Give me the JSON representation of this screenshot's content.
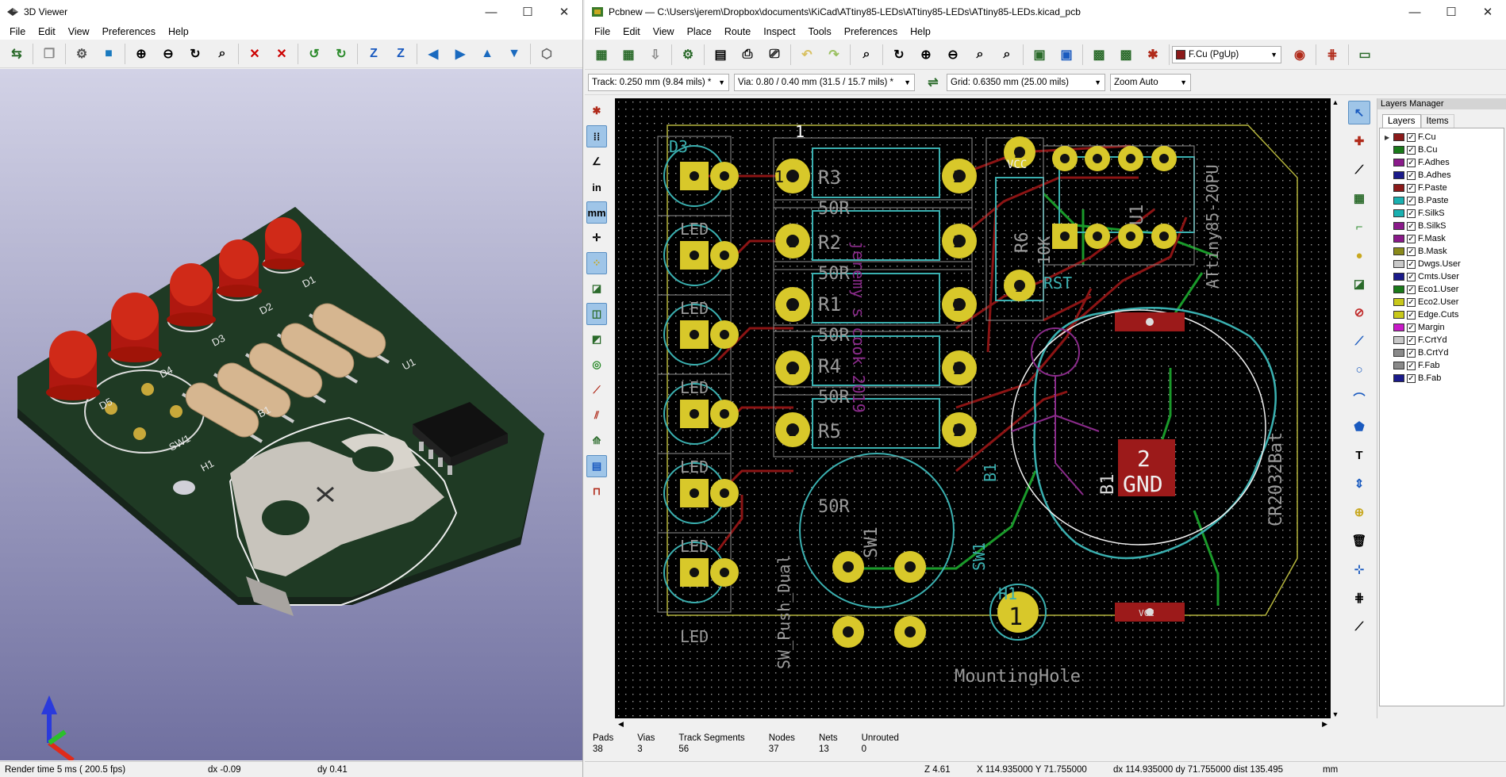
{
  "viewer": {
    "title": "3D Viewer",
    "controls": {
      "min": "—",
      "max": "☐",
      "close": "✕"
    },
    "menu": [
      "File",
      "Edit",
      "View",
      "Preferences",
      "Help"
    ],
    "status": {
      "render": "Render time 5 ms ( 200.5 fps)",
      "dx": "dx -0.09",
      "dy": "dy 0.41"
    },
    "board": {
      "silk": [
        "D5",
        "D4",
        "D3",
        "D2",
        "D1",
        "SW1",
        "H1",
        "B1",
        "U1"
      ],
      "accent": "#1e2f1c"
    }
  },
  "pcbnew": {
    "title": "Pcbnew — C:\\Users\\jerem\\Dropbox\\documents\\KiCad\\ATtiny85-LEDs\\ATtiny85-LEDs\\ATtiny85-LEDs.kicad_pcb",
    "controls": {
      "min": "—",
      "max": "☐",
      "close": "✕"
    },
    "menu": [
      "File",
      "Edit",
      "View",
      "Place",
      "Route",
      "Inspect",
      "Tools",
      "Preferences",
      "Help"
    ],
    "layer_select": "F.Cu (PgUp)",
    "track": "Track: 0.250 mm (9.84 mils) *",
    "via": "Via: 0.80 / 0.40 mm (31.5 / 15.7 mils) *",
    "grid": "Grid: 0.6350 mm (25.00 mils)",
    "zoom": "Zoom Auto",
    "left_tools": {
      "in": "in",
      "mm": "mm"
    },
    "layers_manager": {
      "title": "Layers Manager",
      "tabs": [
        "Layers",
        "Items"
      ],
      "layers": [
        {
          "name": "F.Cu",
          "color": "#8b1a1a"
        },
        {
          "name": "B.Cu",
          "color": "#1a7a1a"
        },
        {
          "name": "F.Adhes",
          "color": "#8a1a8a"
        },
        {
          "name": "B.Adhes",
          "color": "#1a1a8a"
        },
        {
          "name": "F.Paste",
          "color": "#8b1a1a"
        },
        {
          "name": "B.Paste",
          "color": "#1ab0b0"
        },
        {
          "name": "F.SilkS",
          "color": "#1ab0b0"
        },
        {
          "name": "B.SilkS",
          "color": "#8a1a8a"
        },
        {
          "name": "F.Mask",
          "color": "#8a1a8a"
        },
        {
          "name": "B.Mask",
          "color": "#8a8a1a"
        },
        {
          "name": "Dwgs.User",
          "color": "#c8c8c8"
        },
        {
          "name": "Cmts.User",
          "color": "#1a1a8a"
        },
        {
          "name": "Eco1.User",
          "color": "#1a7a1a"
        },
        {
          "name": "Eco2.User",
          "color": "#c8c81a"
        },
        {
          "name": "Edge.Cuts",
          "color": "#c8c81a"
        },
        {
          "name": "Margin",
          "color": "#c81ac8"
        },
        {
          "name": "F.CrtYd",
          "color": "#c8c8c8"
        },
        {
          "name": "B.CrtYd",
          "color": "#8a8a8a"
        },
        {
          "name": "F.Fab",
          "color": "#8a8a8a"
        },
        {
          "name": "B.Fab",
          "color": "#1a1a8a"
        }
      ]
    },
    "stats": [
      {
        "label": "Pads",
        "value": "38"
      },
      {
        "label": "Vias",
        "value": "3"
      },
      {
        "label": "Track Segments",
        "value": "56"
      },
      {
        "label": "Nodes",
        "value": "37"
      },
      {
        "label": "Nets",
        "value": "13"
      },
      {
        "label": "Unrouted",
        "value": "0"
      }
    ],
    "status": {
      "zoom": "Z 4.61",
      "xy": "X 114.935000  Y 71.755000",
      "dxy": "dx 114.935000  dy 71.755000  dist 135.495",
      "units": "mm"
    },
    "canvas": {
      "refs": [
        "R3",
        "R2",
        "R1",
        "R4",
        "R5",
        "R6",
        "U1",
        "D3",
        "B1",
        "SW1",
        "H1"
      ],
      "values": [
        "50R",
        "50R",
        "50R",
        "50R",
        "50R",
        "10K",
        "LED",
        "LED",
        "LED",
        "LED",
        "LED",
        "LED"
      ],
      "pad_numbers": {
        "one": "1",
        "two": "2"
      },
      "labels": {
        "vcc": "VCC",
        "rst": "RST",
        "gnd": "GND",
        "attiny": "ATtiny85-20PU",
        "cr2032": "CR2032Bat",
        "mounting": "MountingHole",
        "sw_push": "SW_Push_Dual",
        "author": "jeremy s cook 2019"
      }
    }
  }
}
